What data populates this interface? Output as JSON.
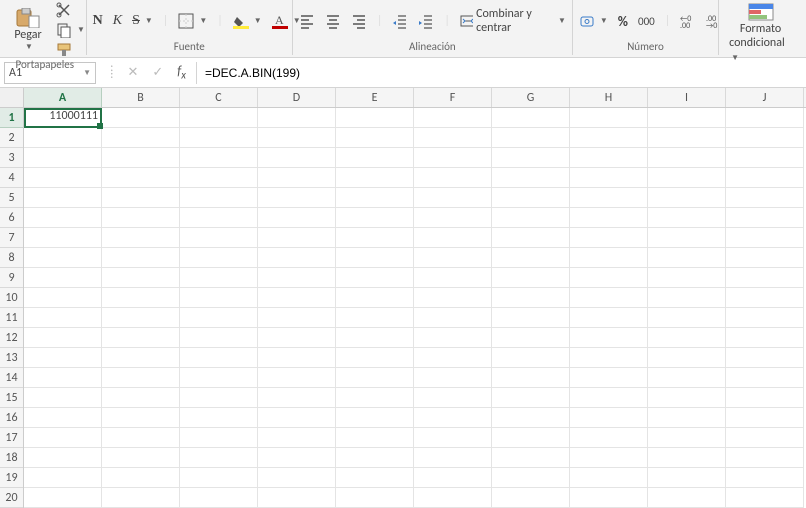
{
  "ribbon": {
    "paste": {
      "label": "Pegar"
    },
    "clipboard_label": "Portapapeles",
    "font": {
      "bold": "N",
      "italic": "K",
      "underline": "S",
      "label": "Fuente"
    },
    "alignment": {
      "merge_label": "Combinar y centrar",
      "label": "Alineación"
    },
    "number": {
      "pct": "%",
      "thou": "000",
      "label": "Número"
    },
    "styles": {
      "cond_format1": "Formato",
      "cond_format2": "condicional"
    }
  },
  "formula_bar": {
    "name_box": "A1",
    "formula": "=DEC.A.BIN(199)"
  },
  "chart_data": {
    "type": "table",
    "columns": [
      "A",
      "B",
      "C",
      "D",
      "E",
      "F",
      "G",
      "H",
      "I",
      "J"
    ],
    "rows": [
      1,
      2,
      3,
      4,
      5,
      6,
      7,
      8,
      9,
      10,
      11,
      12,
      13,
      14,
      15,
      16,
      17,
      18,
      19,
      20
    ],
    "cells": {
      "A1": "11000111"
    },
    "selection": "A1"
  }
}
